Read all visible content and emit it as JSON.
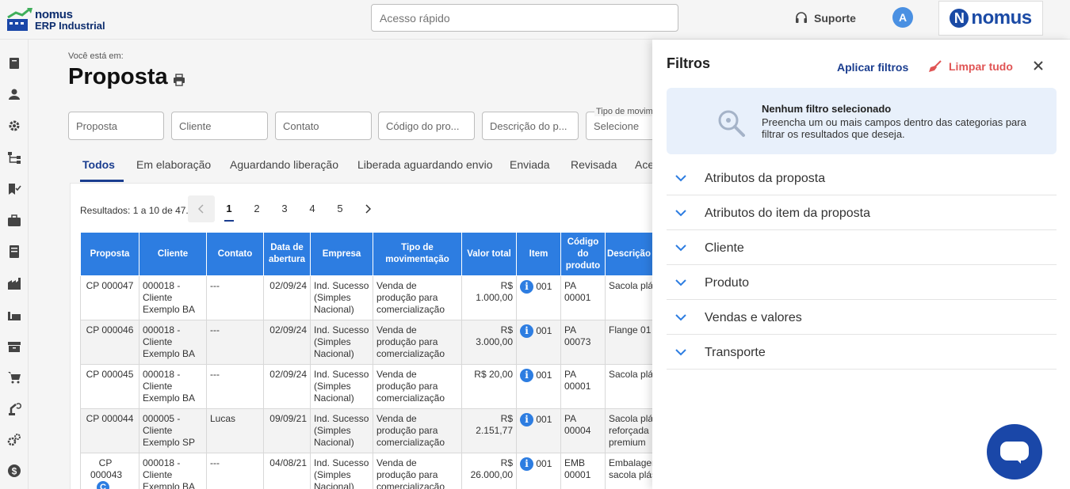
{
  "app": {
    "logo_line1": "nomus",
    "logo_line2": "ERP Industrial",
    "quick_access_placeholder": "Acesso rápido",
    "support_label": "Suporte",
    "avatar_letter": "A",
    "brand_text": "nomus"
  },
  "sidebar": {
    "items": [
      {
        "icon": "book-icon"
      },
      {
        "icon": "user-icon"
      },
      {
        "icon": "gear-icon"
      },
      {
        "icon": "workflow-icon"
      },
      {
        "icon": "map-check-icon"
      },
      {
        "icon": "briefcase-icon"
      },
      {
        "icon": "document-icon"
      },
      {
        "icon": "factory-icon"
      },
      {
        "icon": "forklift-icon"
      },
      {
        "icon": "archive-icon"
      },
      {
        "icon": "cart-icon"
      },
      {
        "icon": "robot-arm-icon"
      },
      {
        "icon": "gears-icon"
      },
      {
        "icon": "dollar-icon"
      }
    ]
  },
  "page": {
    "breadcrumb": "Você está em:",
    "title": "Proposta"
  },
  "search_fields": {
    "proposta": "Proposta",
    "cliente": "Cliente",
    "contato": "Contato",
    "codigo_produto": "Código do pro...",
    "descricao_produto": "Descrição do p...",
    "tipo_label": "Tipo de movim",
    "tipo_value": "Selecione"
  },
  "tabs": [
    "Todos",
    "Em elaboração",
    "Aguardando liberação",
    "Liberada aguardando envio",
    "Enviada",
    "Revisada",
    "Ace"
  ],
  "results": {
    "summary": "Resultados: 1 a 10 de 47.",
    "pages": [
      "1",
      "2",
      "3",
      "4",
      "5"
    ],
    "current_page": "1"
  },
  "table": {
    "headers": [
      "Proposta",
      "Cliente",
      "Contato",
      "Data de abertura",
      "Empresa",
      "Tipo de movimentação",
      "Valor total",
      "Item",
      "Código do produto",
      "Descrição produto"
    ],
    "rows": [
      {
        "proposta": "CP 000047",
        "cliente": "000018 - Cliente Exemplo BA",
        "contato": "---",
        "data": "02/09/24",
        "empresa": "Ind. Sucesso (Simples Nacional)",
        "tipo": "Venda de produção para comercialização",
        "valor": "R$ 1.000,00",
        "item": "001",
        "codigo": "PA 00001",
        "descricao": "Sacola plás"
      },
      {
        "proposta": "CP 000046",
        "cliente": "000018 - Cliente Exemplo BA",
        "contato": "---",
        "data": "02/09/24",
        "empresa": "Ind. Sucesso (Simples Nacional)",
        "tipo": "Venda de produção para comercialização",
        "valor": "R$ 3.000,00",
        "item": "001",
        "codigo": "PA 00073",
        "descricao": "Flange 01"
      },
      {
        "proposta": "CP 000045",
        "cliente": "000018 - Cliente Exemplo BA",
        "contato": "---",
        "data": "02/09/24",
        "empresa": "Ind. Sucesso (Simples Nacional)",
        "tipo": "Venda de produção para comercialização",
        "valor": "R$ 20,00",
        "item": "001",
        "codigo": "PA 00001",
        "descricao": "Sacola plás"
      },
      {
        "proposta": "CP 000044",
        "cliente": "000005 - Cliente Exemplo SP",
        "contato": "Lucas",
        "data": "09/09/21",
        "empresa": "Ind. Sucesso (Simples Nacional)",
        "tipo": "Venda de produção para comercialização",
        "valor": "R$ 2.151,77",
        "item": "001",
        "codigo": "PA 00004",
        "descricao": "Sacola plás reforçada premium"
      },
      {
        "proposta": "CP 000043",
        "badge": "C",
        "cliente": "000018 - Cliente Exemplo BA",
        "contato": "---",
        "data": "04/08/21",
        "empresa": "Ind. Sucesso (Simples Nacional)",
        "tipo": "Venda de produção para comercialização",
        "valor": "R$ 26.000,00",
        "item": "001",
        "codigo": "EMB 00001",
        "descricao": "Embalagen sacola plás"
      }
    ]
  },
  "filters": {
    "title": "Filtros",
    "apply_label": "Aplicar filtros",
    "clear_label": "Limpar tudo",
    "empty_heading": "Nenhum filtro selecionado",
    "empty_text": "Preencha um ou mais campos dentro das categorias para filtrar os resultados que deseja.",
    "categories": [
      "Atributos da proposta",
      "Atributos do item da proposta",
      "Cliente",
      "Produto",
      "Vendas e valores",
      "Transporte"
    ]
  },
  "colors": {
    "brand": "#1a47a8",
    "table_header": "#2d7de1",
    "clear": "#e05555"
  }
}
